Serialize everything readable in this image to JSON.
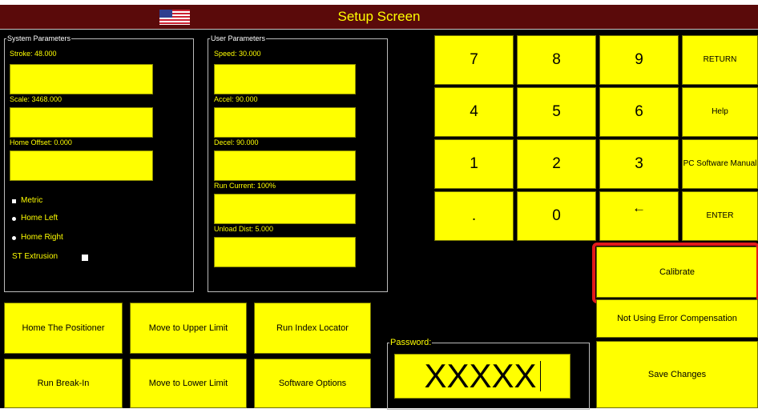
{
  "window": {
    "title": "Setup Screen"
  },
  "system_parameters": {
    "legend": "System Parameters",
    "stroke_label": "Stroke: 48.000",
    "scale_label": "Scale: 3468.000",
    "home_offset_label": "Home Offset: 0.000",
    "metric_label": "Metric",
    "home_left_label": "Home Left",
    "home_right_label": "Home Right",
    "st_extrusion_label": "ST Extrusion"
  },
  "user_parameters": {
    "legend": "User Parameters",
    "speed_label": "Speed: 30.000",
    "accel_label": "Accel: 90.000",
    "decel_label": "Decel: 90.000",
    "run_current_label": "Run Current: 100%",
    "unload_dist_label": "Unload Dist: 5.000"
  },
  "keypad": {
    "keys": [
      "7",
      "8",
      "9",
      "4",
      "5",
      "6",
      "1",
      "2",
      "3",
      ".",
      "0",
      "←"
    ],
    "return_label": "RETURN",
    "help_label": "Help",
    "pc_manual_label": "PC Software Manual",
    "enter_label": "ENTER"
  },
  "right_buttons": {
    "calibrate_label": "Calibrate",
    "error_comp_label": "Not Using Error Compensation",
    "save_label": "Save Changes"
  },
  "actions": {
    "home_label": "Home The Positioner",
    "upper_limit_label": "Move to Upper Limit",
    "index_locator_label": "Run Index Locator",
    "break_in_label": "Run Break-In",
    "lower_limit_label": "Move to Lower Limit",
    "software_options_label": "Software Options"
  },
  "password": {
    "legend": "Password:",
    "value": "XXXXX"
  },
  "colors": {
    "accent": "#ffff00",
    "title_bar": "#5a0a0a",
    "highlight": "#e21b1b",
    "background": "#000000"
  }
}
